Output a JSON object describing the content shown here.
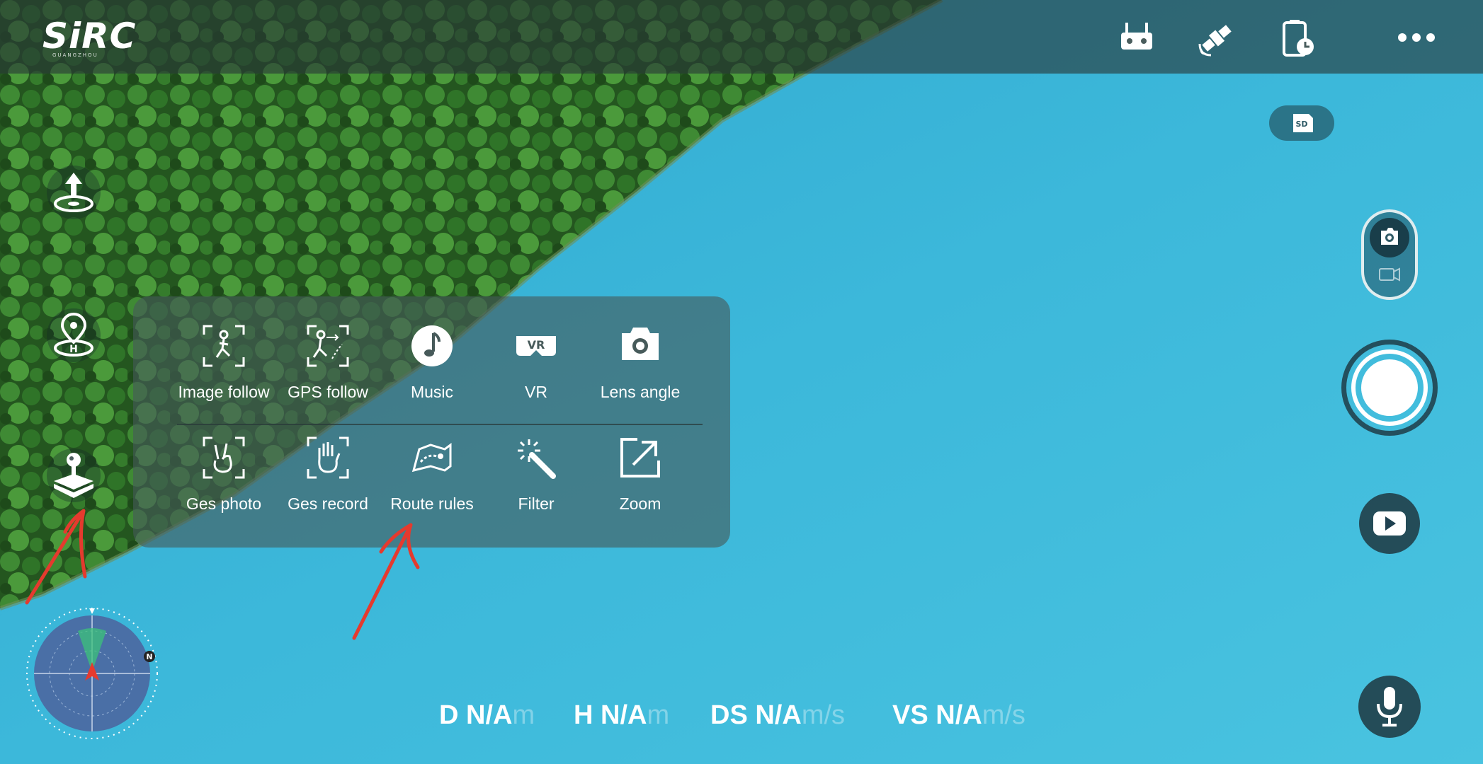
{
  "app": {
    "logo_text": "SiRC",
    "logo_subtext": "GUANGZHOU"
  },
  "topbar": {
    "icons": [
      "remote-controller-icon",
      "satellite-icon",
      "phone-battery-icon",
      "more-icon"
    ]
  },
  "sidebar": {
    "icons": [
      "takeoff-icon",
      "return-home-icon",
      "joystick-icon"
    ]
  },
  "menu": {
    "row1": [
      {
        "label": "Image follow",
        "icon": "image-follow-icon"
      },
      {
        "label": "GPS follow",
        "icon": "gps-follow-icon"
      },
      {
        "label": "Music",
        "icon": "music-icon"
      },
      {
        "label": "VR",
        "icon": "vr-icon"
      },
      {
        "label": "Lens angle",
        "icon": "lens-angle-icon"
      }
    ],
    "row2": [
      {
        "label": "Ges photo",
        "icon": "gesture-photo-icon"
      },
      {
        "label": "Ges record",
        "icon": "gesture-record-icon"
      },
      {
        "label": "Route rules",
        "icon": "route-rules-icon"
      },
      {
        "label": "Filter",
        "icon": "filter-icon"
      },
      {
        "label": "Zoom",
        "icon": "zoom-icon"
      }
    ]
  },
  "right": {
    "sd_label": "SD",
    "mode": "photo",
    "icons": [
      "camera-icon",
      "video-camera-icon",
      "shutter-button",
      "playback-icon",
      "microphone-icon"
    ]
  },
  "compass": {
    "north_label": "N"
  },
  "telemetry": [
    {
      "label": "D",
      "value": "N/A",
      "unit": "m"
    },
    {
      "label": "H",
      "value": "N/A",
      "unit": "m"
    },
    {
      "label": "DS",
      "value": "N/A",
      "unit": "m/s"
    },
    {
      "label": "VS",
      "value": "N/A",
      "unit": "m/s"
    }
  ],
  "colors": {
    "water": "#3bb3d6",
    "forest": "#2f6b2b",
    "annotation": "#e53a2e"
  }
}
